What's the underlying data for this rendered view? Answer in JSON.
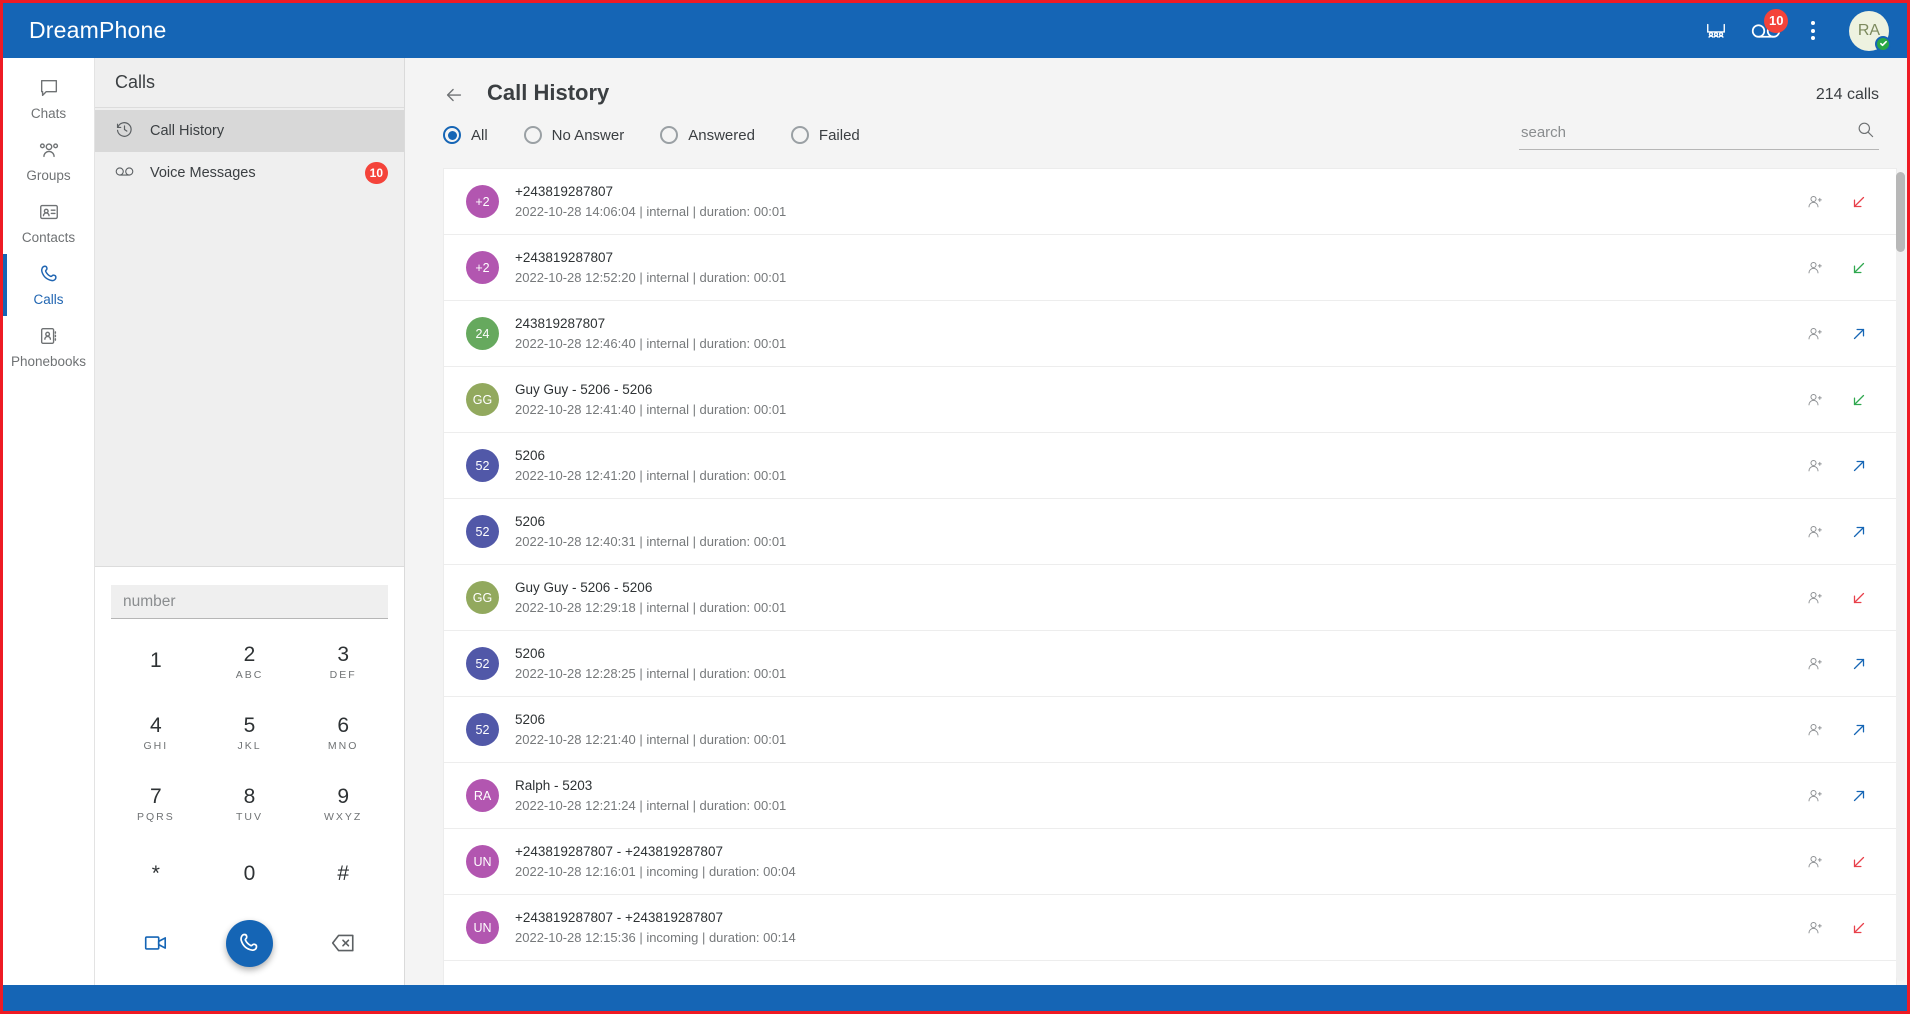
{
  "topbar": {
    "brand": "DreamPhone",
    "conference_icon": "conference-icon",
    "voicemail_icon": "voicemail-icon",
    "voicemail_badge": "10",
    "more_icon": "kebab-menu-icon",
    "avatar_initials": "RA",
    "presence": "online"
  },
  "rail": {
    "items": [
      {
        "label": "Chats",
        "icon": "chat-bubble-icon",
        "active": false
      },
      {
        "label": "Groups",
        "icon": "people-group-icon",
        "active": false
      },
      {
        "label": "Contacts",
        "icon": "contact-card-icon",
        "active": false
      },
      {
        "label": "Calls",
        "icon": "phone-handset-icon",
        "active": true
      },
      {
        "label": "Phonebooks",
        "icon": "address-book-icon",
        "active": false
      }
    ]
  },
  "panel": {
    "title": "Calls",
    "items": [
      {
        "label": "Call History",
        "icon": "history-clock-icon",
        "selected": true,
        "badge": ""
      },
      {
        "label": "Voice Messages",
        "icon": "voicemail-icon",
        "selected": false,
        "badge": "10"
      }
    ]
  },
  "dialpad": {
    "number_value": "",
    "number_placeholder": "number",
    "keys": [
      {
        "digit": "1",
        "letters": ""
      },
      {
        "digit": "2",
        "letters": "ABC"
      },
      {
        "digit": "3",
        "letters": "DEF"
      },
      {
        "digit": "4",
        "letters": "GHI"
      },
      {
        "digit": "5",
        "letters": "JKL"
      },
      {
        "digit": "6",
        "letters": "MNO"
      },
      {
        "digit": "7",
        "letters": "PQRS"
      },
      {
        "digit": "8",
        "letters": "TUV"
      },
      {
        "digit": "9",
        "letters": "WXYZ"
      },
      {
        "digit": "*",
        "letters": ""
      },
      {
        "digit": "0",
        "letters": ""
      },
      {
        "digit": "#",
        "letters": ""
      }
    ],
    "video_call_icon": "video-camera-icon",
    "call_icon": "phone-handset-icon",
    "backspace_icon": "backspace-icon"
  },
  "main": {
    "back_icon": "arrow-left-icon",
    "title": "Call History",
    "calls_count": "214 calls",
    "filters": [
      {
        "label": "All",
        "selected": true
      },
      {
        "label": "No Answer",
        "selected": false
      },
      {
        "label": "Answered",
        "selected": false
      },
      {
        "label": "Failed",
        "selected": false
      }
    ],
    "search": {
      "value": "",
      "placeholder": "search",
      "icon": "search-icon"
    }
  },
  "colors": {
    "brand_blue": "#1565b5",
    "badge_red": "#f4433a",
    "missed_red": "#e8404a",
    "answered_green": "#2fa84f",
    "outgoing_blue": "#1565b5",
    "frame_red": "#ee1b24"
  },
  "call_rows": [
    {
      "initials": "+2",
      "avatar_color": "#b256b0",
      "title": "+243819287807",
      "subtitle": "2022-10-28 14:06:04 | internal | duration: 00:01",
      "direction": "in-missed",
      "add_icon": "add-contact-icon"
    },
    {
      "initials": "+2",
      "avatar_color": "#b256b0",
      "title": "+243819287807",
      "subtitle": "2022-10-28 12:52:20 | internal | duration: 00:01",
      "direction": "in-ok",
      "add_icon": "add-contact-icon"
    },
    {
      "initials": "24",
      "avatar_color": "#66a95e",
      "title": "243819287807",
      "subtitle": "2022-10-28 12:46:40 | internal | duration: 00:01",
      "direction": "out",
      "add_icon": "add-contact-icon"
    },
    {
      "initials": "GG",
      "avatar_color": "#92a95e",
      "title": "Guy Guy - 5206  - 5206",
      "subtitle": "2022-10-28 12:41:40 | internal | duration: 00:01",
      "direction": "in-ok",
      "add_icon": "add-contact-icon"
    },
    {
      "initials": "52",
      "avatar_color": "#5158a8",
      "title": "5206",
      "subtitle": "2022-10-28 12:41:20 | internal | duration: 00:01",
      "direction": "out",
      "add_icon": "add-contact-icon"
    },
    {
      "initials": "52",
      "avatar_color": "#5158a8",
      "title": "5206",
      "subtitle": "2022-10-28 12:40:31 | internal | duration: 00:01",
      "direction": "out",
      "add_icon": "add-contact-icon"
    },
    {
      "initials": "GG",
      "avatar_color": "#92a95e",
      "title": "Guy Guy - 5206  - 5206",
      "subtitle": "2022-10-28 12:29:18 | internal | duration: 00:01",
      "direction": "in-missed",
      "add_icon": "add-contact-icon"
    },
    {
      "initials": "52",
      "avatar_color": "#5158a8",
      "title": "5206",
      "subtitle": "2022-10-28 12:28:25 | internal | duration: 00:01",
      "direction": "out",
      "add_icon": "add-contact-icon"
    },
    {
      "initials": "52",
      "avatar_color": "#5158a8",
      "title": "5206",
      "subtitle": "2022-10-28 12:21:40 | internal | duration: 00:01",
      "direction": "out",
      "add_icon": "add-contact-icon"
    },
    {
      "initials": "RA",
      "avatar_color": "#b256b0",
      "title": "Ralph  - 5203",
      "subtitle": "2022-10-28 12:21:24 | internal | duration: 00:01",
      "direction": "out",
      "add_icon": "add-contact-icon"
    },
    {
      "initials": "UN",
      "avatar_color": "#b256b0",
      "title": "+243819287807  - +243819287807",
      "subtitle": "2022-10-28 12:16:01 | incoming | duration: 00:04",
      "direction": "in-missed",
      "add_icon": "add-contact-icon"
    },
    {
      "initials": "UN",
      "avatar_color": "#b256b0",
      "title": "+243819287807  - +243819287807",
      "subtitle": "2022-10-28 12:15:36 | incoming | duration: 00:14",
      "direction": "in-missed",
      "add_icon": "add-contact-icon"
    }
  ]
}
